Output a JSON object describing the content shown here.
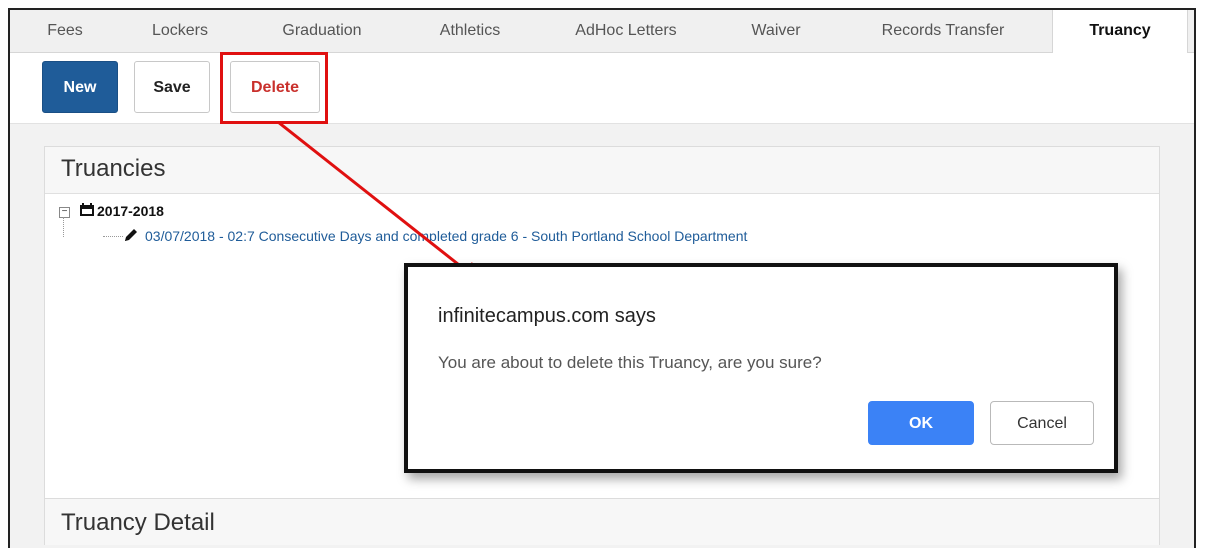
{
  "tabs": [
    {
      "label": "Fees"
    },
    {
      "label": "Lockers"
    },
    {
      "label": "Graduation"
    },
    {
      "label": "Athletics"
    },
    {
      "label": "AdHoc Letters"
    },
    {
      "label": "Waiver"
    },
    {
      "label": "Records Transfer"
    },
    {
      "label": "Truancy",
      "active": true
    }
  ],
  "toolbar": {
    "new_label": "New",
    "save_label": "Save",
    "delete_label": "Delete"
  },
  "truancies_panel": {
    "title": "Truancies",
    "tree": {
      "year": "2017-2018",
      "record": "03/07/2018 - 02:7 Consecutive Days and completed grade 6 - South Portland School Department"
    }
  },
  "detail_panel": {
    "title": "Truancy Detail"
  },
  "dialog": {
    "origin": "infinitecampus.com says",
    "message": "You are about to delete this Truancy, are you sure?",
    "ok_label": "OK",
    "cancel_label": "Cancel"
  },
  "icons": {
    "calendar": "calendar-icon",
    "pencil": "pencil-icon",
    "tree_toggle": "collapse-icon"
  },
  "colors": {
    "primary": "#1f5c99",
    "delete_text": "#c9302c",
    "highlight": "#e01010",
    "ok_button": "#3b82f6"
  }
}
